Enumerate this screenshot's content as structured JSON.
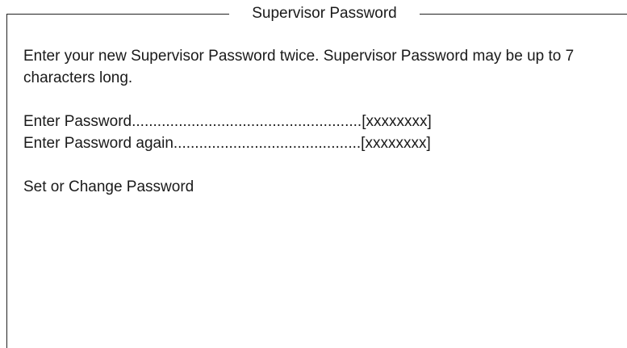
{
  "dialog": {
    "title": "Supervisor Password",
    "description": "Enter your new Supervisor Password twice.  Supervisor Password may be up to 7 characters long.",
    "fields": [
      {
        "label": "Enter Password",
        "leader": "......................................................",
        "value": "[xxxxxxxx]"
      },
      {
        "label": "Enter Password again",
        "leader": "............................................",
        "value": "[xxxxxxxx]"
      }
    ],
    "action": "Set or Change Password"
  }
}
